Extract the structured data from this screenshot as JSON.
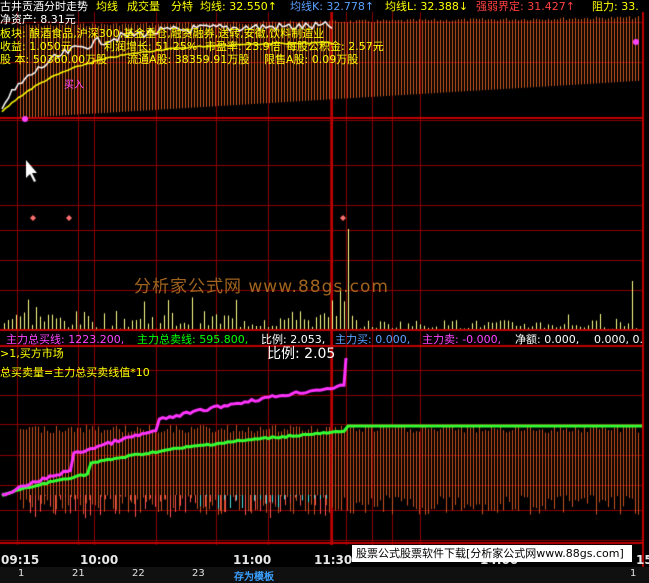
{
  "header": {
    "title": "古井贡酒分时走势",
    "items": [
      {
        "label": "均线",
        "color": "#ffff00"
      },
      {
        "label": "成交量",
        "color": "#ffff00"
      },
      {
        "label": "分特",
        "color": "#ffff00"
      },
      {
        "label": "均线: 32.550↑",
        "color": "#ffff00"
      },
      {
        "label": "均线K: 32.778↑",
        "color": "#5aa0ff"
      },
      {
        "label": "均线L: 32.388↓",
        "color": "#ffff00"
      },
      {
        "label": "强弱界定: 31.427↑",
        "color": "#ff4040"
      },
      {
        "label": "阻力: 33.",
        "color": "#ffff00"
      }
    ]
  },
  "info": {
    "net_assets": "净资产: 8.31元",
    "sector": "板块: 酿酒食品,沪深300,基金重仓,融资融券,送转,安徽,饮料制造业",
    "eps": "收益: 1.050元",
    "profit_growth": "利润增长: 51.25%",
    "pe": "市盈率: 23.9倍",
    "reserve": "每股公积金: 2.57元",
    "share_capital": "股 本: 50360.00万股",
    "float_a": "流通A股: 38359.91万股",
    "restricted": "限售A股: 0.09万股",
    "buy_marker": "买入"
  },
  "indicator_bar": {
    "buy_total": "主力总买线: 1223.200,",
    "sell_total": "主力总卖线: 595.800,",
    "ratio": "比例: 2.053,",
    "main_buy": "主力买: 0.000,",
    "main_sell": "主力卖: -0.000,",
    "net": "净额: 0.000,",
    "extra": "0.000, 0."
  },
  "lower_panel": {
    "market_state": ">1,买方市场",
    "formula": "总买卖量=主力总买卖线值*10",
    "ratio_label": "比例: 2.05"
  },
  "xaxis": {
    "labels": [
      "09:15",
      "10:00",
      "11:00",
      "11:30",
      "14:00",
      "15"
    ]
  },
  "banner": "股票公式股票软件下载[分析家公式网www.88gs.com]",
  "watermark": "分析家公式网  www.88gs.com",
  "tabs": [
    "1",
    "21",
    "22",
    "23",
    "存为模板",
    "1"
  ],
  "active_tab": 4,
  "colors": {
    "grid": "#8b0000",
    "price": "#ffffff",
    "avg": "#ffff00",
    "buy_line": "#ff33ff",
    "sell_line": "#33ff33",
    "volume": "#ffff88"
  }
}
